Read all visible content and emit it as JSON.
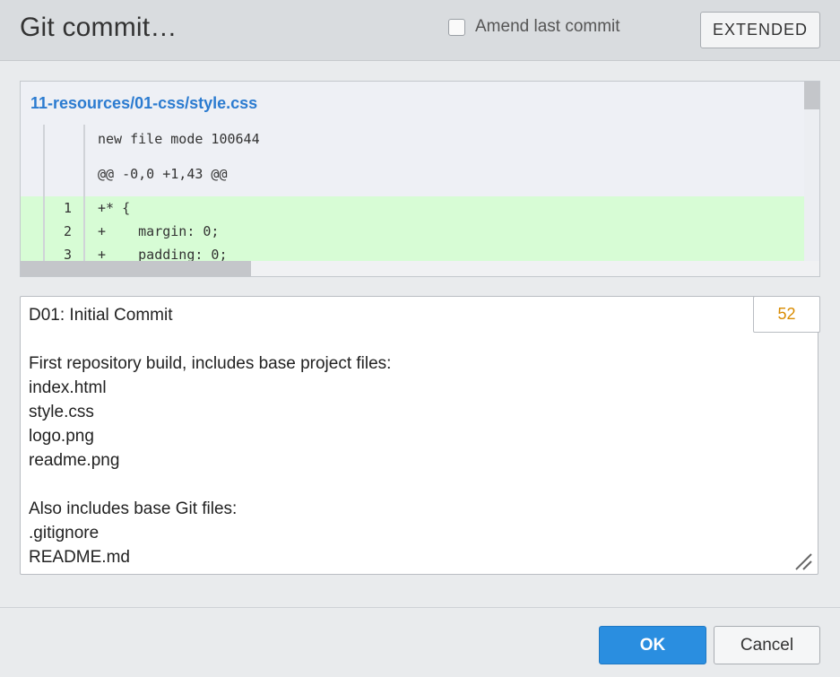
{
  "dialog": {
    "title": "Git commit…",
    "amend_label": "Amend last commit",
    "amend_checked": false,
    "extended_label": "EXTENDED"
  },
  "diff": {
    "file_path": "11-resources/01-css/style.css",
    "meta_lines": [
      "new file mode 100644",
      "@@ -0,0 +1,43 @@"
    ],
    "added_lines": [
      {
        "number": "1",
        "code": "+* {"
      },
      {
        "number": "2",
        "code": "+    margin: 0;"
      },
      {
        "number": "3",
        "code": "+    padding: 0;"
      }
    ],
    "added_color": "#d7fcd5"
  },
  "commit": {
    "message": "D01: Initial Commit\n\nFirst repository build, includes base project files:\nindex.html\nstyle.css\nlogo.png\nreadme.png\n\nAlso includes base Git files:\n.gitignore\nREADME.md",
    "char_count": "52",
    "count_color": "#d98b00"
  },
  "footer": {
    "ok_label": "OK",
    "cancel_label": "Cancel",
    "ok_color": "#2a8ee0"
  },
  "icons": {
    "checkbox": "checkbox-icon",
    "resize": "resize-grip-icon"
  }
}
